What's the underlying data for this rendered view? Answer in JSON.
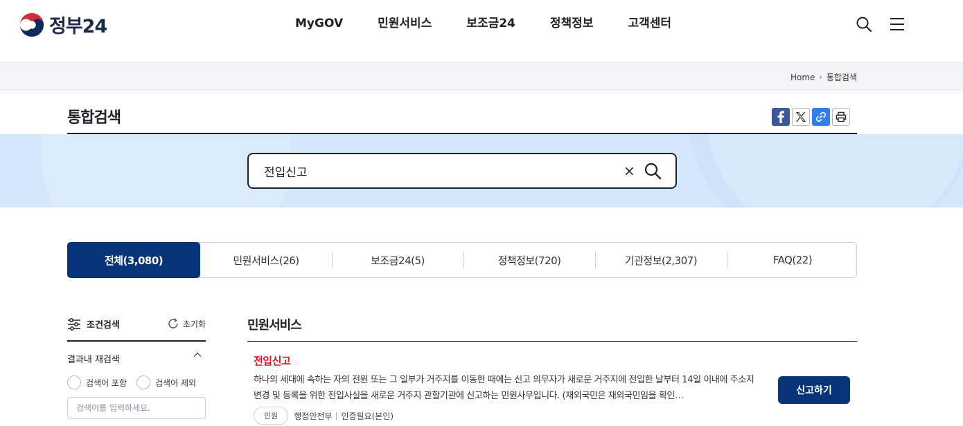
{
  "header": {
    "logo_text": "정부24",
    "nav": [
      "MyGOV",
      "민원서비스",
      "보조금24",
      "정책정보",
      "고객센터"
    ]
  },
  "breadcrumb": {
    "home": "Home",
    "current": "통합검색"
  },
  "page": {
    "title": "통합검색"
  },
  "search": {
    "value": "전입신고",
    "clear_glyph": "×"
  },
  "tabs": [
    {
      "label": "전체(3,080)",
      "active": true
    },
    {
      "label": "민원서비스(26)"
    },
    {
      "label": "보조금24(5)"
    },
    {
      "label": "정책정보(720)"
    },
    {
      "label": "기관정보(2,307)"
    },
    {
      "label": "FAQ(22)"
    }
  ],
  "filter": {
    "title": "조건검색",
    "reset_label": "초기화",
    "refine_label": "결과내 재검색",
    "radio_include": "검색어 포함",
    "radio_exclude": "검색어 제외",
    "input_placeholder": "검색어를 입력하세요."
  },
  "results": {
    "section_title": "민원서비스",
    "item": {
      "title": "전입신고",
      "description": "하나의 세대에 속하는 자의 전원 또는 그 일부가 거주지를 이동한 때에는 신고 의무자가 새로운 거주지에 전입한 날부터 14일 이내에 주소지변경 및 등록을 위한 전입사실을 새로운 거주지 관할기관에 신고하는 민원사무입니다. (재외국민은 재외국민임을 확인…",
      "badge": "민원",
      "agency": "행정안전부",
      "auth": "인증필요(본인)",
      "button": "신고하기"
    }
  },
  "colors": {
    "primary": "#09347a",
    "accent_red": "#d6171e",
    "band": "#d4e8fb"
  }
}
